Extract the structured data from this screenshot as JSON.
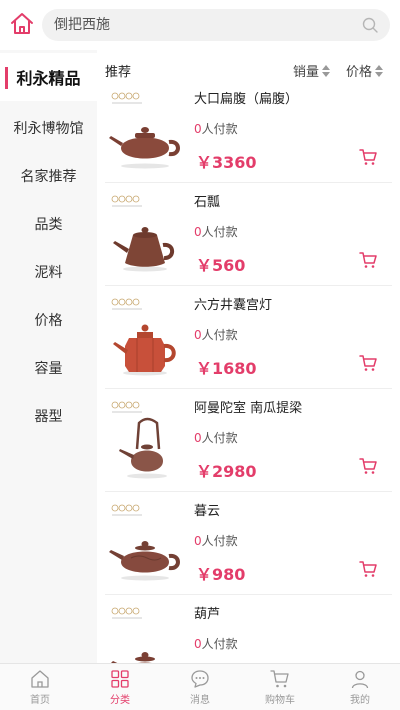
{
  "search": {
    "placeholder": "倒把西施"
  },
  "colors": {
    "accent": "#e33d6a",
    "sidebar_bg": "#f7f7f7",
    "teapot": "#8a4a3c",
    "teapot_red": "#c8503a"
  },
  "sidebar": {
    "items": [
      {
        "label": "利永精品",
        "active": true
      },
      {
        "label": "利永博物馆",
        "active": false
      },
      {
        "label": "名家推荐",
        "active": false
      },
      {
        "label": "品类",
        "active": false
      },
      {
        "label": "泥料",
        "active": false
      },
      {
        "label": "价格",
        "active": false
      },
      {
        "label": "容量",
        "active": false
      },
      {
        "label": "器型",
        "active": false
      }
    ]
  },
  "list_header": {
    "title": "推荐",
    "sort_sales": "销量",
    "sort_price": "价格"
  },
  "products": [
    {
      "name": "大口扁腹（扁腹）",
      "count_num": "0",
      "count_suffix": "人付款",
      "price": "￥3360",
      "icon": "teapot"
    },
    {
      "name": "石瓢",
      "count_num": "0",
      "count_suffix": "人付款",
      "price": "￥560",
      "icon": "teapot"
    },
    {
      "name": "六方井囊宫灯",
      "count_num": "0",
      "count_suffix": "人付款",
      "price": "￥1680",
      "icon": "teapot"
    },
    {
      "name": "阿曼陀室 南瓜提梁",
      "count_num": "0",
      "count_suffix": "人付款",
      "price": "￥2980",
      "icon": "teapot"
    },
    {
      "name": "暮云",
      "count_num": "0",
      "count_suffix": "人付款",
      "price": "￥980",
      "icon": "teapot"
    },
    {
      "name": "葫芦",
      "count_num": "0",
      "count_suffix": "人付款",
      "price": "",
      "icon": "teapot"
    }
  ],
  "tabbar": {
    "items": [
      {
        "label": "首页",
        "icon": "home-icon",
        "active": false
      },
      {
        "label": "分类",
        "icon": "category-icon",
        "active": true
      },
      {
        "label": "消息",
        "icon": "message-icon",
        "active": false
      },
      {
        "label": "购物车",
        "icon": "cart-icon",
        "active": false
      },
      {
        "label": "我的",
        "icon": "user-icon",
        "active": false
      }
    ]
  }
}
